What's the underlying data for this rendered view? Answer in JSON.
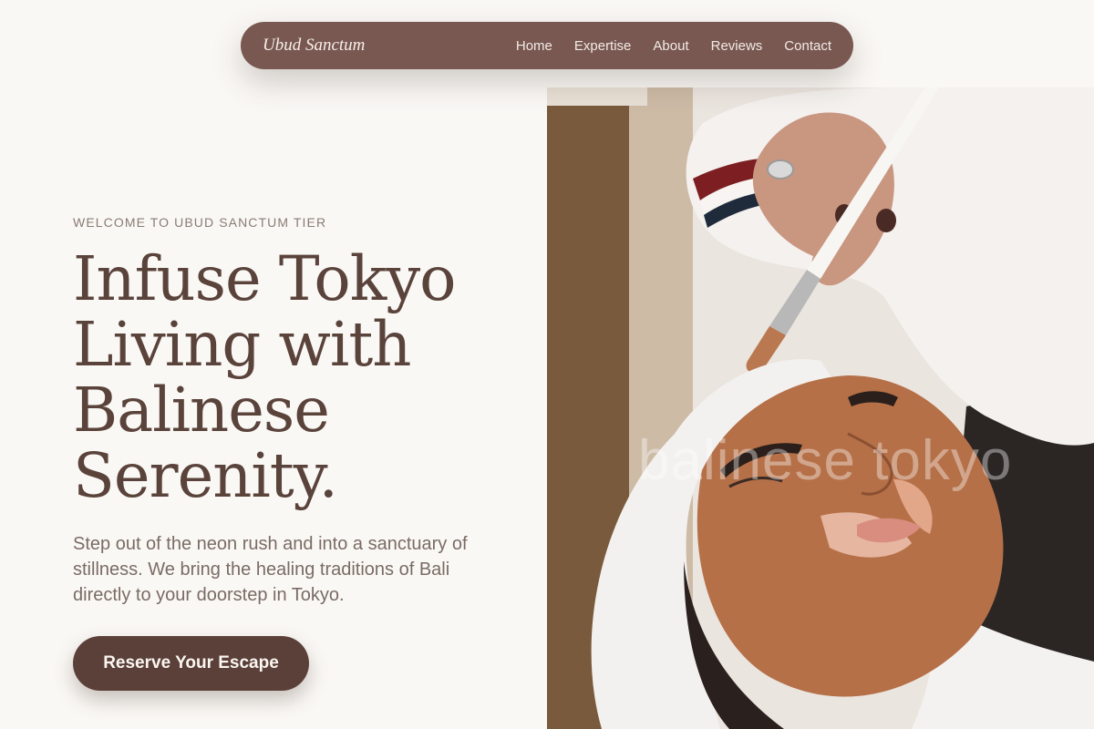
{
  "nav": {
    "brand": "Ubud Sanctum",
    "links": [
      "Home",
      "Expertise",
      "About",
      "Reviews",
      "Contact"
    ]
  },
  "hero": {
    "eyebrow": "WELCOME TO UBUD SANCTUM TIER",
    "headline": "Infuse Tokyo Living with Balinese Serenity.",
    "lead": "Step out of the neon rush and into a sanctuary of stillness. We bring the healing traditions of Bali directly to your doorstep in Tokyo.",
    "cta_label": "Reserve Your Escape",
    "image_watermark": "balinese tokyo"
  },
  "colors": {
    "background": "#faf8f5",
    "nav_bg": "#795851",
    "primary": "#5a4038",
    "headline": "#5a433b",
    "muted_text": "#7a6b64"
  }
}
